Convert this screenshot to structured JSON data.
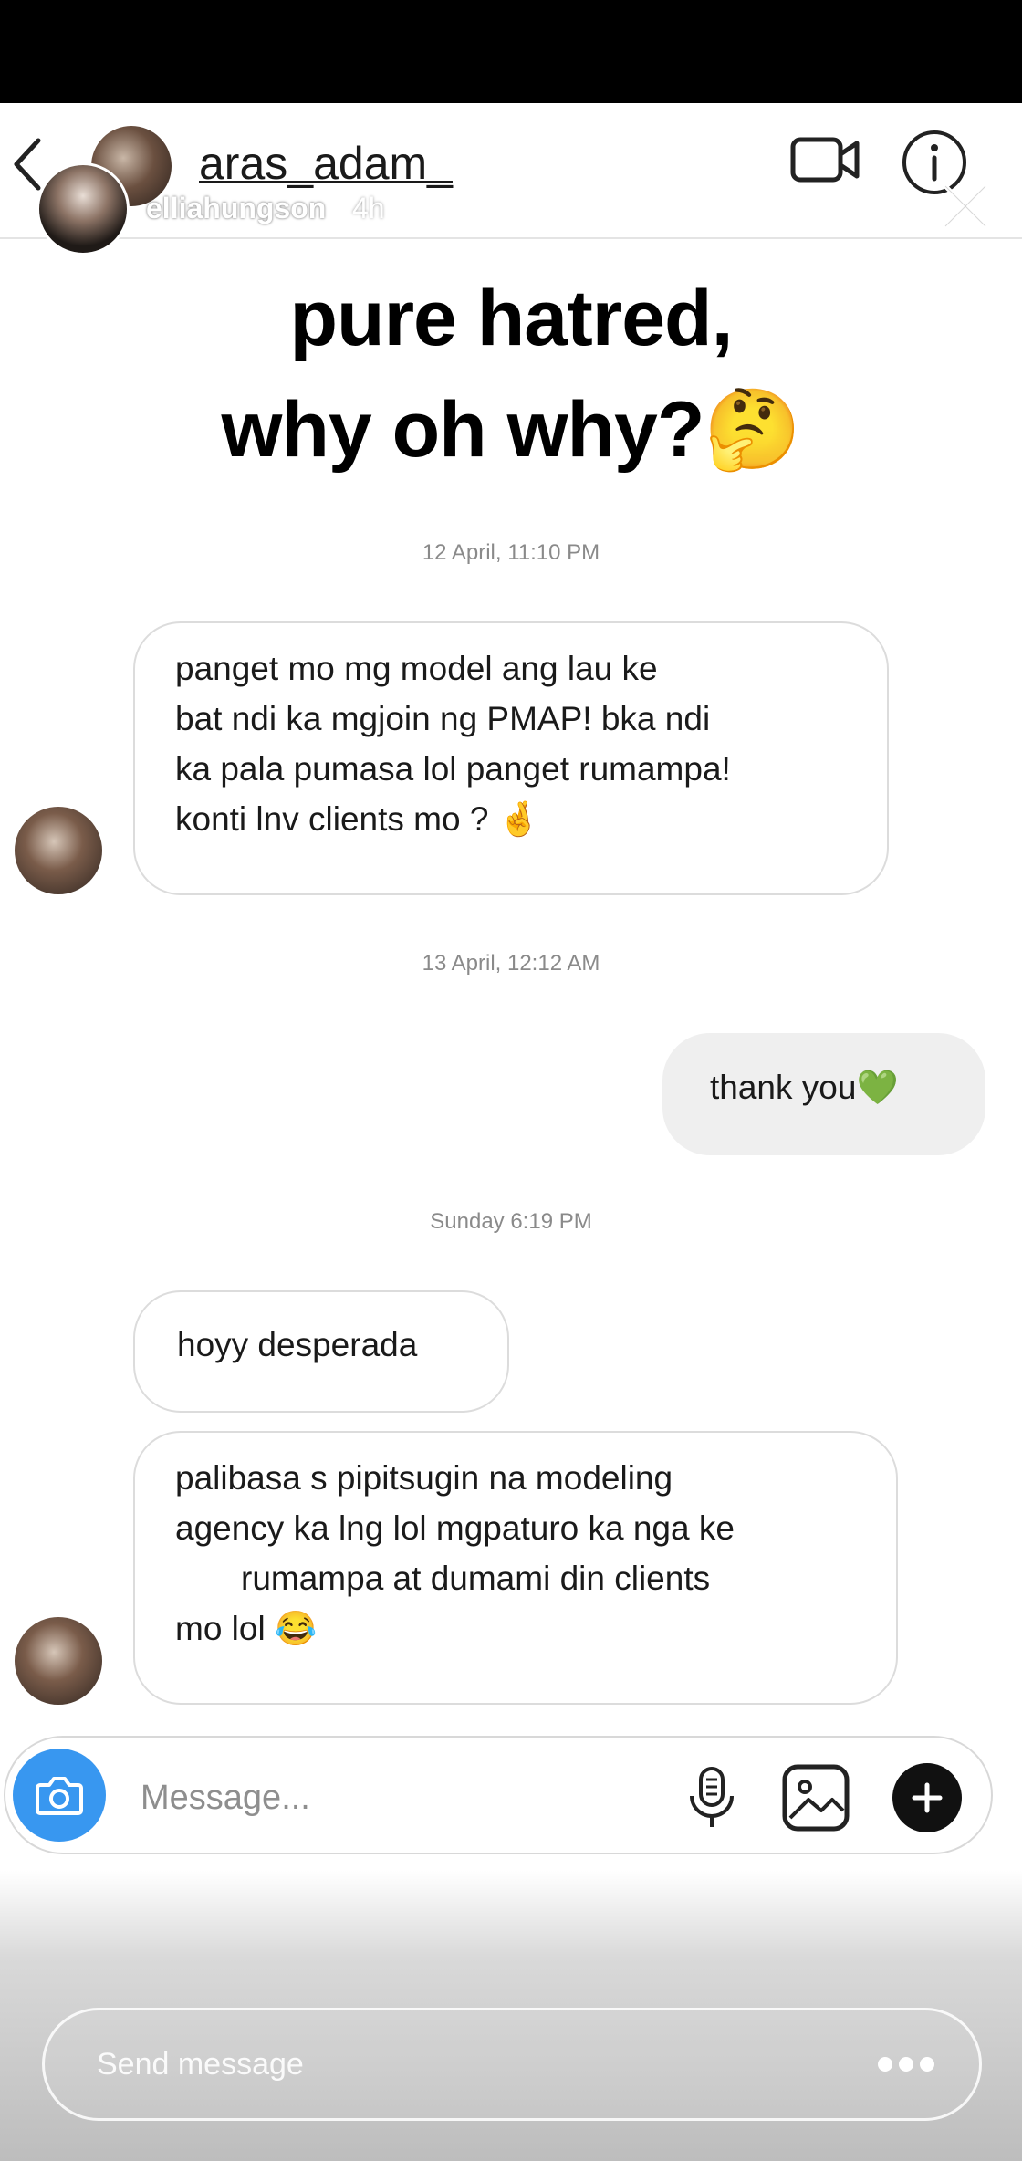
{
  "dm_header": {
    "username": "aras_adam_"
  },
  "story": {
    "username": "elliahungson",
    "time": "4h"
  },
  "caption": {
    "line1": "pure hatred,",
    "line2": "why oh why?🤔"
  },
  "thread": {
    "ts1": "12 April, 11:10 PM",
    "msg1": [
      "panget mo mg model ang lau ke",
      "bat ndi ka mgjoin ng PMAP! bka ndi",
      "ka pala pumasa lol panget rumampa!",
      "konti lnv clients mo ? 🤞"
    ],
    "ts2": "13 April, 12:12 AM",
    "msg2": "thank you💚",
    "ts3": "Sunday 6:19 PM",
    "msg3": "hoyy desperada",
    "msg4": [
      "palibasa s pipitsugin na modeling",
      "agency ka lng lol mgpaturo ka nga ke",
      "rumampa at dumami din clients",
      "mo lol 😂"
    ]
  },
  "composer": {
    "placeholder": "Message..."
  },
  "story_reply": {
    "placeholder": "Send message"
  },
  "colors": {
    "camera_button": "#3897f0",
    "sent_bubble": "#efefef",
    "border": "#dcdcdc"
  },
  "icons": [
    "back-icon",
    "video-call-icon",
    "info-icon",
    "close-icon",
    "camera-icon",
    "microphone-icon",
    "gallery-icon",
    "plus-icon",
    "more-icon"
  ]
}
